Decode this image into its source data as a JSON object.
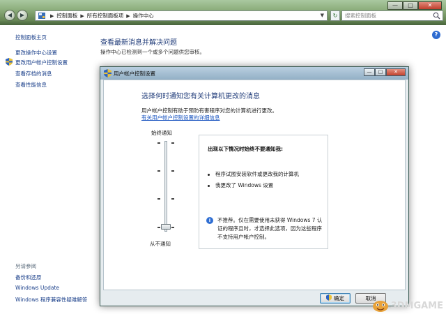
{
  "outer_window": {
    "breadcrumb": [
      "控制面板",
      "所有控制面板项",
      "操作中心"
    ],
    "search_placeholder": "搜索控制面板",
    "controls": {
      "minimize": "—",
      "maximize": "□",
      "close": "✕"
    }
  },
  "sidebar": {
    "items": [
      {
        "label": "控制面板主页"
      },
      {
        "label": "更改操作中心设置"
      },
      {
        "label": "更改用户帐户控制设置"
      },
      {
        "label": "查看存档的消息"
      },
      {
        "label": "查看性能信息"
      }
    ],
    "see_also_title": "另请参阅",
    "see_also_items": [
      {
        "label": "备份和还原"
      },
      {
        "label": "Windows Update"
      },
      {
        "label": "Windows 程序兼容性疑难解答"
      }
    ]
  },
  "main": {
    "title": "查看最新消息并解决问题",
    "subtitle": "操作中心已检测到一个或多个问题供您审核。"
  },
  "dialog": {
    "title": "用户帐户控制设置",
    "heading": "选择何时通知您有关计算机更改的消息",
    "description": "用户帐户控制有助于预防有害程序对您的计算机进行更改。",
    "link": "有关用户帐户控制设置的详细信息",
    "slider": {
      "top_label": "始终通知",
      "bottom_label": "从不通知",
      "level": 0,
      "levels": 4
    },
    "info": {
      "title": "出现以下情况时始终不要通知我:",
      "bullets": [
        "程序试图安装软件或更改我的计算机",
        "我更改了 Windows 设置"
      ],
      "note": "不推荐。仅在需要使用未获得 Windows 7 认证的程序且时，才选择此选项，因为这些程序不支持用户帐户控制。"
    },
    "buttons": {
      "ok": "确定",
      "cancel": "取消"
    },
    "controls": {
      "minimize": "—",
      "maximize": "□",
      "close": "✕"
    }
  },
  "watermark": {
    "text": "3DMGAME"
  },
  "colors": {
    "link": "#1a3f8a",
    "heading": "#1e3a78",
    "accent": "#2f6ed3"
  }
}
